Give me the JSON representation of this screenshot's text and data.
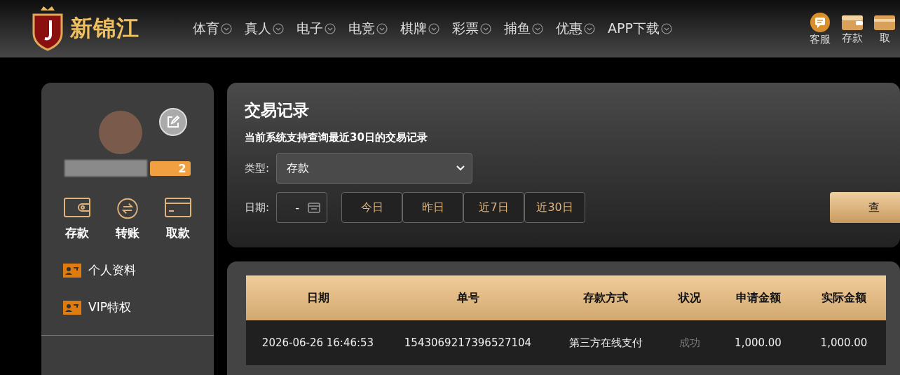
{
  "header": {
    "logo_text": "新锦江",
    "nav": [
      {
        "label": "体育"
      },
      {
        "label": "真人"
      },
      {
        "label": "电子"
      },
      {
        "label": "电竞"
      },
      {
        "label": "棋牌"
      },
      {
        "label": "彩票"
      },
      {
        "label": "捕鱼"
      },
      {
        "label": "优惠"
      },
      {
        "label": "APP下载"
      }
    ],
    "actions": [
      {
        "kind": "chat",
        "label": "客服"
      },
      {
        "kind": "wallet",
        "label": "存款"
      },
      {
        "kind": "card",
        "label": "取"
      }
    ]
  },
  "sidebar": {
    "vip_badge": "2",
    "quick_actions": [
      {
        "kind": "wallet",
        "label": "存款"
      },
      {
        "kind": "transfer",
        "label": "转账"
      },
      {
        "kind": "card",
        "label": "取款"
      }
    ],
    "menu": [
      {
        "label": "个人资料"
      },
      {
        "label": "VIP特权"
      }
    ]
  },
  "filter": {
    "title": "交易记录",
    "note": "当前系统支持查询最近30日的交易记录",
    "type_label": "类型:",
    "type_value": "存款",
    "date_label": "日期:",
    "date_value": "-",
    "ranges": [
      {
        "label": "今日"
      },
      {
        "label": "昨日"
      },
      {
        "label": "近7日"
      },
      {
        "label": "近30日"
      }
    ],
    "search_button": "查"
  },
  "table": {
    "columns": [
      "日期",
      "单号",
      "存款方式",
      "状况",
      "申请金额",
      "实际金额"
    ],
    "rows": [
      {
        "cells": [
          "2026-06-26 16:46:53",
          "1543069217396527104",
          "第三方在线支付",
          "成功",
          "1,000.00",
          "1,000.00"
        ],
        "status_muted": true
      }
    ]
  }
}
